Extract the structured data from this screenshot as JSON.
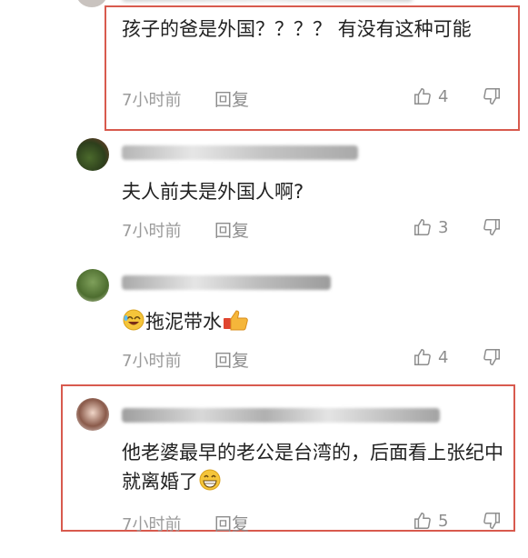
{
  "comments": [
    {
      "username": "",
      "text": "孩子的爸是外国？？？？ 有没有这种可能",
      "time": "7小时前",
      "reply": "回复",
      "likes": "4"
    },
    {
      "username": "",
      "text": "夫人前夫是外国人啊?",
      "time": "7小时前",
      "reply": "回复",
      "likes": "3"
    },
    {
      "username": "",
      "text": "拖泥带水",
      "time": "7小时前",
      "reply": "回复",
      "likes": "4"
    },
    {
      "username": "",
      "text": "他老婆最早的老公是台湾的，后面看上张纪中就离婚了",
      "time": "7小时前",
      "reply": "回复",
      "likes": "5"
    }
  ],
  "colors": {
    "highlight": "#d85a4e",
    "muted": "#9b9b9b",
    "text": "#222222"
  }
}
